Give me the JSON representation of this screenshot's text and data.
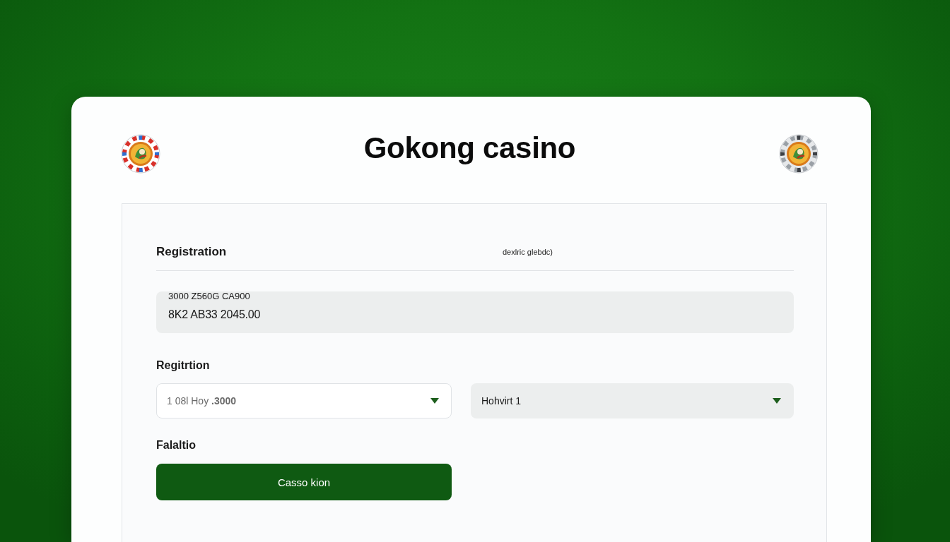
{
  "header": {
    "title": "Gokong casino"
  },
  "form": {
    "heading": "Registration",
    "note": "dexlric glebdc)",
    "code_box": {
      "line_1": "3000 Z560G CA900",
      "line_2": "8K2 AB33 2045.00"
    },
    "section_label": "Regitrtion",
    "selects": [
      {
        "kind": "outlined",
        "value": "1 08l Hoy **.3000**"
      },
      {
        "kind": "filled",
        "value": "Hohvirt 1"
      }
    ],
    "footer_label": "Falaltio",
    "submit_button": "Casso kion"
  }
}
